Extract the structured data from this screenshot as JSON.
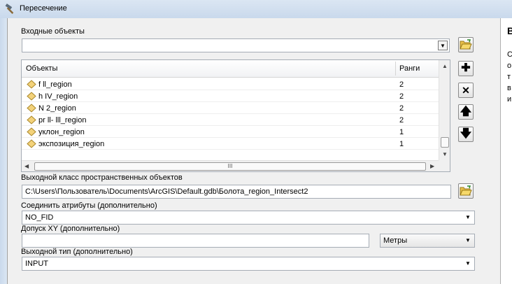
{
  "window": {
    "title": "Пересечение"
  },
  "input_features": {
    "label": "Входные объекты",
    "value": ""
  },
  "table": {
    "col_objects": "Объекты",
    "col_ranks": "Ранги",
    "rows": [
      {
        "name": "f ll_region",
        "rank": "2"
      },
      {
        "name": "h IV_region",
        "rank": "2"
      },
      {
        "name": "N 2_region",
        "rank": "2"
      },
      {
        "name": "pr ll- lll_region",
        "rank": "2"
      },
      {
        "name": "уклон_region",
        "rank": "1"
      },
      {
        "name": "экспозиция_region",
        "rank": "1"
      }
    ],
    "hscroll_grip": "III"
  },
  "output_class": {
    "label": "Выходной класс пространственных объектов",
    "value": "C:\\Users\\Пользователь\\Documents\\ArcGIS\\Default.gdb\\Болота_region_Intersect2"
  },
  "join_attributes": {
    "label": "Соединить атрибуты (дополнительно)",
    "value": "NO_FID"
  },
  "xy_tolerance": {
    "label": "Допуск XY (дополнительно)",
    "value": "",
    "unit": "Метры"
  },
  "output_type": {
    "label": "Выходной тип (дополнительно)",
    "value": "INPUT"
  },
  "help_panel": {
    "title": "В",
    "lines": [
      "С",
      "о",
      "т",
      "в",
      "и"
    ]
  },
  "icons": {
    "title": "hammer-icon",
    "folder": "folder-open-icon",
    "add": "plus-icon",
    "remove": "x-icon",
    "up": "arrow-up-icon",
    "down": "arrow-down-icon",
    "row": "feature-class-diamond-icon"
  }
}
